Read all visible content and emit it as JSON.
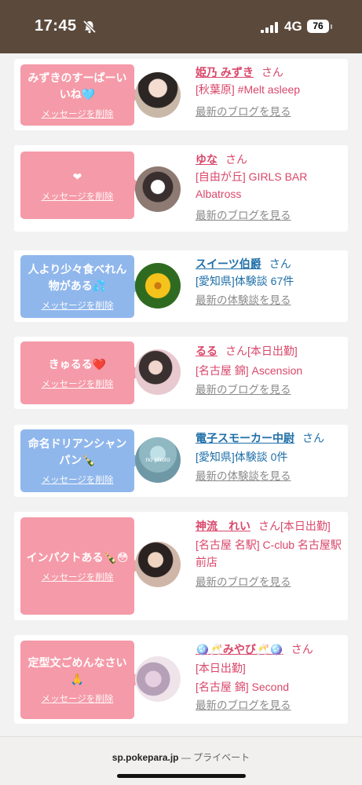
{
  "status_bar": {
    "time": "17:45",
    "network": "4G",
    "battery": "76"
  },
  "cards": [
    {
      "message": "みずきのすーぱーいいね🩵",
      "delete_label": "メッセージを削除",
      "bubble_color": "pink",
      "name": "姫乃 みずき",
      "honorific": "さん",
      "name_suffix": "",
      "lines": [
        "[秋葉原] #Melt asleep"
      ],
      "link": "最新のブログを見る",
      "text_color": "red"
    },
    {
      "message": "❤︎",
      "delete_label": "メッセージを削除",
      "bubble_color": "pink",
      "name": "ゆな",
      "honorific": "さん",
      "name_suffix": "",
      "lines": [
        "[自由が丘] GIRLS BAR Albatross"
      ],
      "link": "最新のブログを見る",
      "text_color": "red"
    },
    {
      "message": "人より少々食べれん物がある💦",
      "delete_label": "メッセージを削除",
      "bubble_color": "blue",
      "name": "スイーツ伯爵",
      "honorific": "さん",
      "name_suffix": "",
      "lines": [
        "[愛知県]体験談 67件"
      ],
      "link": "最新の体験談を見る",
      "text_color": "blue"
    },
    {
      "message": "きゅるる❤️",
      "delete_label": "メッセージを削除",
      "bubble_color": "pink",
      "name": "るる",
      "honorific": "さん",
      "name_suffix": "[本日出勤]",
      "lines": [
        "[名古屋 錦] Ascension"
      ],
      "link": "最新のブログを見る",
      "text_color": "red"
    },
    {
      "message": "命名ドリアンシャンパン🍾",
      "delete_label": "メッセージを削除",
      "bubble_color": "blue",
      "name": "電子スモーカー中尉",
      "honorific": "さん",
      "name_suffix": "",
      "lines": [
        "[愛知県]体験談 0件"
      ],
      "link": "最新の体験談を見る",
      "text_color": "blue",
      "avatar_text": "no photo"
    },
    {
      "message": "インパクトある🍾😳",
      "delete_label": "メッセージを削除",
      "bubble_color": "pink",
      "name": "神流　れい",
      "honorific": "さん",
      "name_suffix": "[本日出勤]",
      "lines": [
        "[名古屋 名駅] C-club 名古屋駅前店"
      ],
      "link": "最新のブログを見る",
      "text_color": "red"
    },
    {
      "message": "定型文ごめんなさい🙏",
      "delete_label": "メッセージを削除",
      "bubble_color": "pink",
      "name": "🪩🥂みやび🥂🪩",
      "honorific": "さん",
      "name_suffix": "",
      "lines": [
        "[本日出勤]",
        "[名古屋 錦] Second"
      ],
      "link": "最新のブログを見る",
      "text_color": "red"
    }
  ],
  "bottom_bar": {
    "domain": "sp.pokepara.jp",
    "separator": " — ",
    "mode": "プライベート"
  }
}
